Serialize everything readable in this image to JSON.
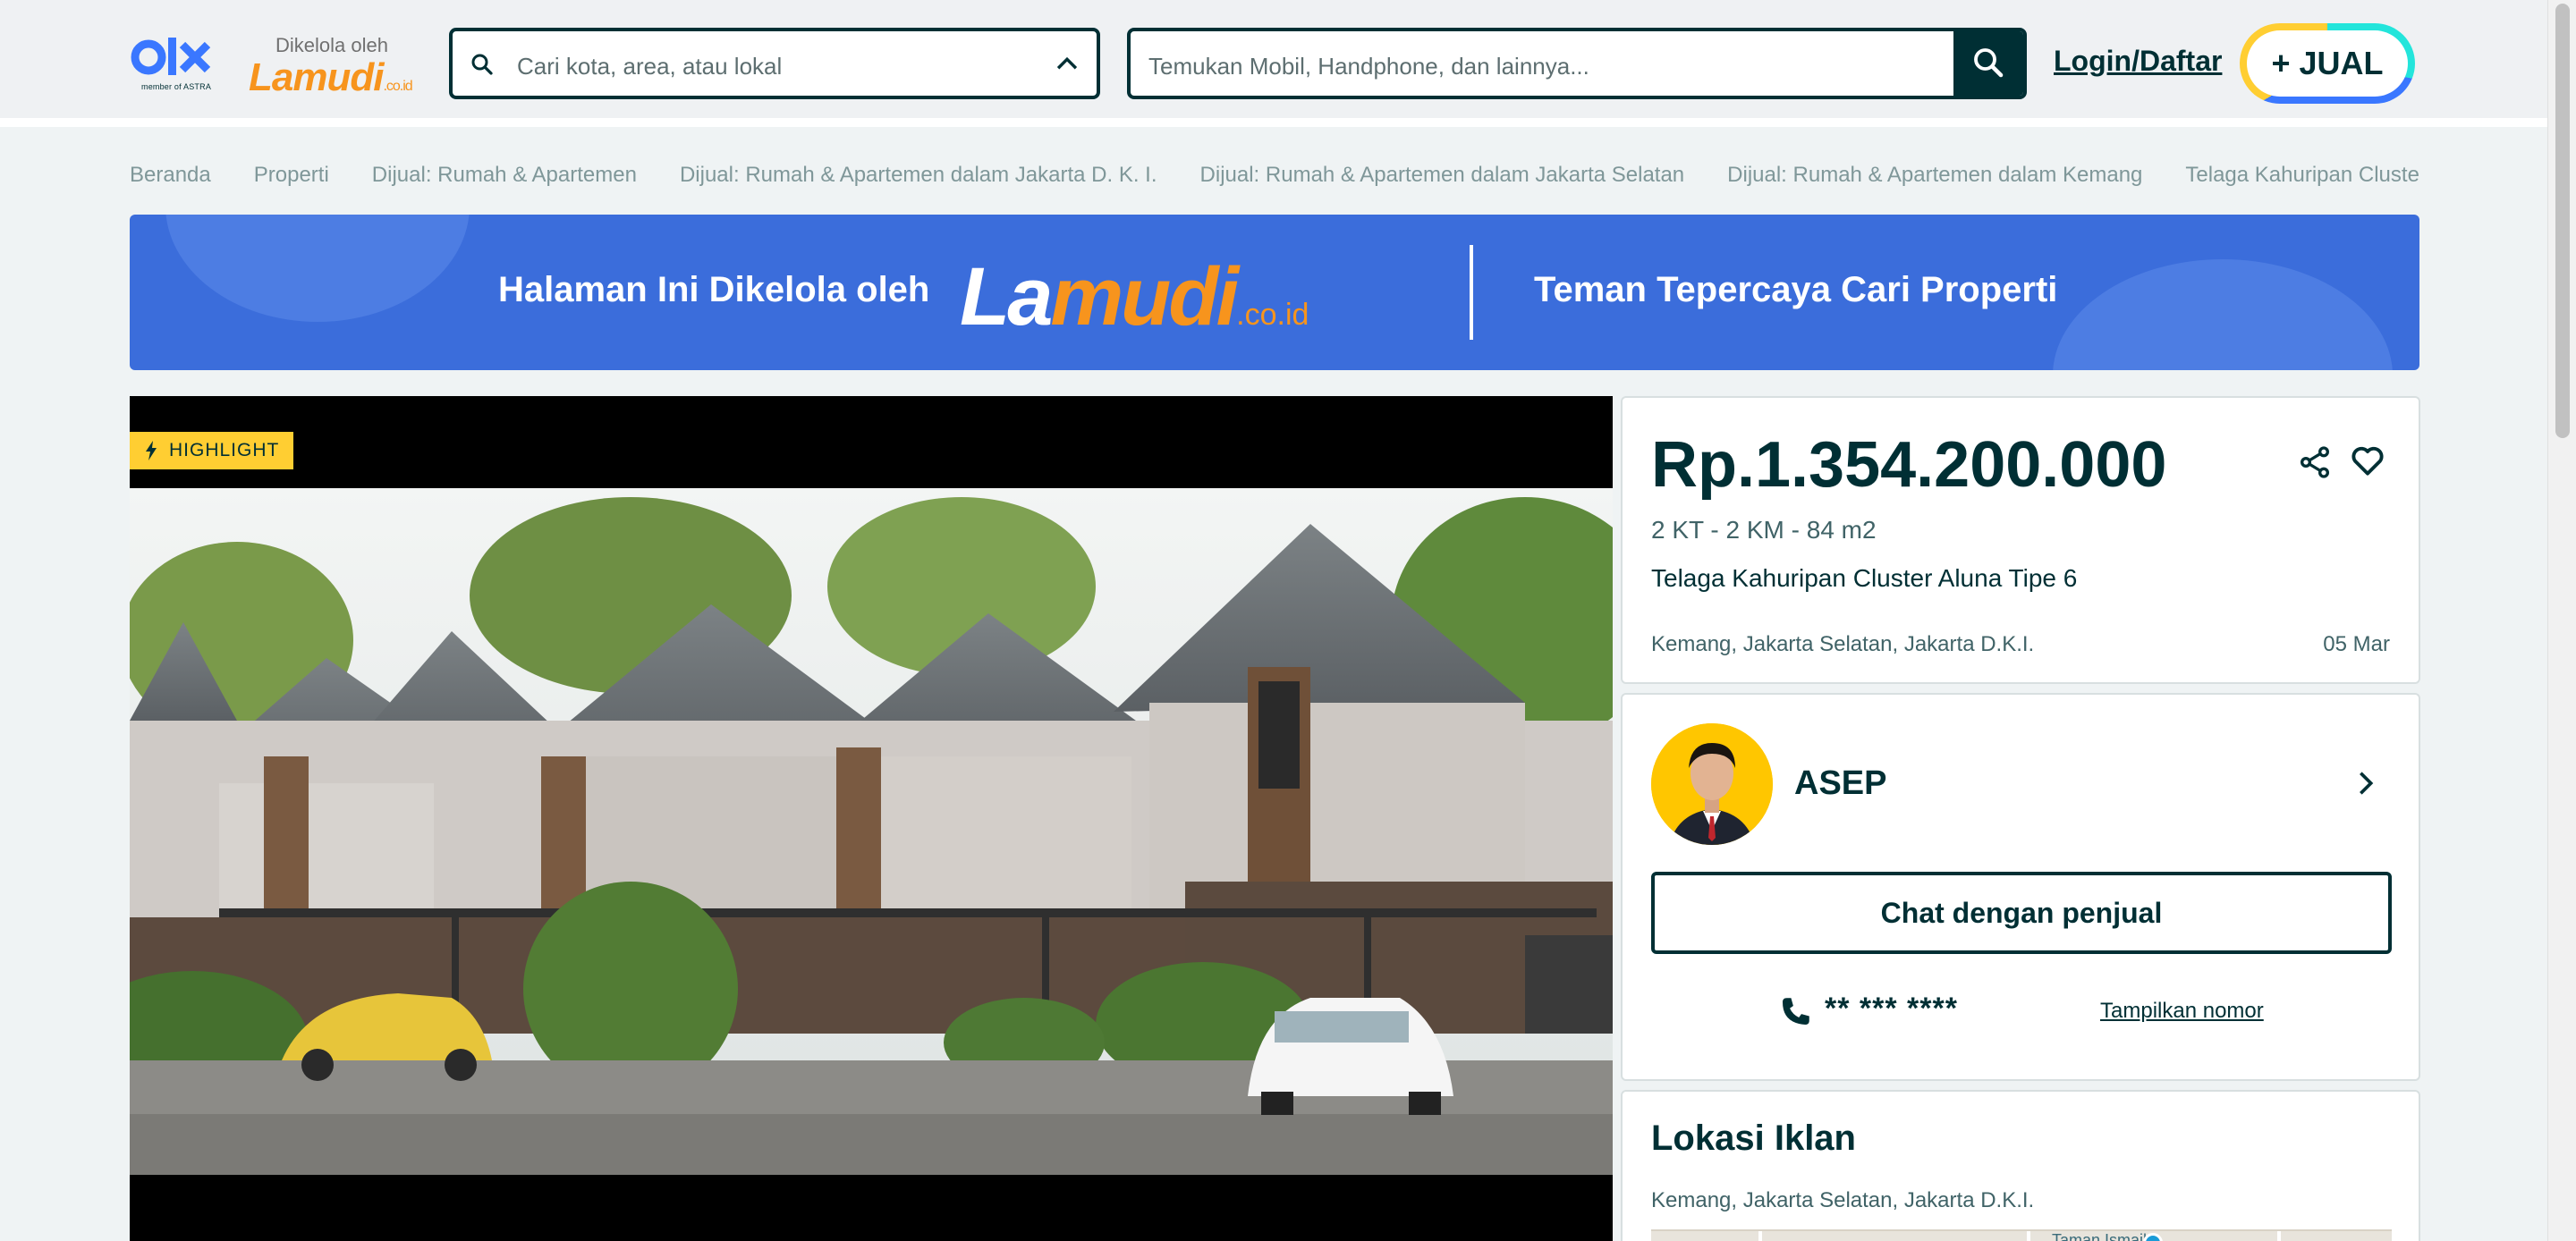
{
  "header": {
    "olx_logo": "olx",
    "olx_sub": "member of ASTRA",
    "managed_by": "Dikelola oleh",
    "lamudi_logo": "Lamudi",
    "lamudi_logo_suffix": ".co.id",
    "location_placeholder": "Cari kota, area, atau lokal",
    "search_placeholder": "Temukan Mobil, Handphone, dan lainnya...",
    "login_label": "Login/Daftar",
    "sell_label": "+ JUAL"
  },
  "breadcrumb": [
    "Beranda",
    "Properti",
    "Dijual: Rumah & Apartemen",
    "Dijual: Rumah & Apartemen dalam Jakarta D. K. I.",
    "Dijual: Rumah & Apartemen dalam Jakarta Selatan",
    "Dijual: Rumah & Apartemen dalam Kemang",
    "Telaga Kahuripan Cluster..."
  ],
  "banner": {
    "left_text": "Halaman Ini Dikelola oleh",
    "logo_la": "La",
    "logo_mudi": "mudi",
    "logo_suffix": ".co.id",
    "right_text": "Teman Tepercaya Cari Properti"
  },
  "gallery": {
    "badge": "HIGHLIGHT"
  },
  "listing": {
    "price": "Rp.1.354.200.000",
    "specs": "2 KT - 2 KM - 84 m2",
    "title": "Telaga Kahuripan Cluster Aluna Tipe 6",
    "location": "Kemang, Jakarta Selatan, Jakarta D.K.I.",
    "date": "05 Mar"
  },
  "seller": {
    "name": "ASEP",
    "chat_label": "Chat dengan penjual",
    "phone_masked": "** *** ****",
    "show_number_label": "Tampilkan nomor"
  },
  "location_section": {
    "title": "Lokasi Iklan",
    "text": "Kemang, Jakarta Selatan, Jakarta D.K.I.",
    "map_label": "Taman Ismail"
  },
  "colors": {
    "primary": "#002f34",
    "banner": "#3b6ddb",
    "lamudi_orange": "#f7941d",
    "highlight": "#ffce32"
  }
}
